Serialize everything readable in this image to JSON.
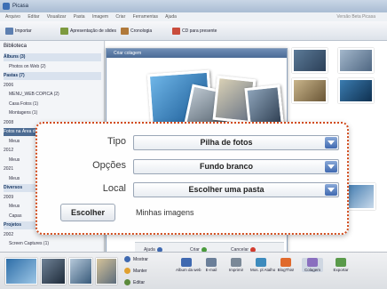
{
  "window": {
    "title": "Picasa",
    "menu": [
      "Arquivo",
      "Editar",
      "Visualizar",
      "Pasta",
      "Imagem",
      "Criar",
      "Ferramentas",
      "Ajuda"
    ],
    "menu_right": "Versão Beta Picasa"
  },
  "toolbar": {
    "import_label": "Importar",
    "slideshow_label": "Apresentação de slides",
    "timeline_label": "Cronologia",
    "cd_label": "CD para presente"
  },
  "sidebar": {
    "title": "Biblioteca",
    "rows": [
      {
        "label": "Álbuns (3)",
        "kind": "group"
      },
      {
        "label": "Photos on Web (2)",
        "kind": "item"
      },
      {
        "label": "Pastas (7)",
        "kind": "group"
      },
      {
        "label": "2006",
        "kind": "year"
      },
      {
        "label": "MENU_WEB COPICA (2)",
        "kind": "item"
      },
      {
        "label": "Casa Fotos (1)",
        "kind": "item"
      },
      {
        "label": "Montagens (1)",
        "kind": "item"
      },
      {
        "label": "2008",
        "kind": "year"
      },
      {
        "label": "Fotos na Área de Trabalho",
        "kind": "selected"
      },
      {
        "label": "Meus",
        "kind": "item"
      },
      {
        "label": "2012",
        "kind": "year"
      },
      {
        "label": "Meus",
        "kind": "item"
      },
      {
        "label": "2021",
        "kind": "year"
      },
      {
        "label": "Meus",
        "kind": "item"
      },
      {
        "label": "Diversos",
        "kind": "group"
      },
      {
        "label": "2009",
        "kind": "year"
      },
      {
        "label": "Meus",
        "kind": "item"
      },
      {
        "label": "Capas",
        "kind": "item"
      },
      {
        "label": "Projetos",
        "kind": "group"
      },
      {
        "label": "2002",
        "kind": "year"
      },
      {
        "label": "Screen Captures (1)",
        "kind": "item"
      }
    ]
  },
  "collage_window": {
    "title": "Criar colagem"
  },
  "collage_footer": {
    "help": "Ajuda",
    "create": "Criar",
    "cancel": "Cancelar"
  },
  "options": {
    "type_label": "Tipo",
    "type_value": "Pilha de fotos",
    "options_label": "Opções",
    "options_value": "Fundo branco",
    "location_label": "Local",
    "location_value": "Escolher uma pasta",
    "choose_button": "Escolher",
    "choose_path": "Minhas imagens"
  },
  "tray": {
    "side_options": [
      "Mostrar",
      "Manter",
      "Editar"
    ],
    "buttons": [
      "Album da web",
      "E-mail",
      "Imprimir",
      "Mos. pl Atalho",
      "BlogThis!",
      "Colagem",
      "Exportar"
    ]
  },
  "colors": {
    "accent": "#3f69b0",
    "callout_border": "#d14a1a",
    "selection": "#4d6c93"
  }
}
